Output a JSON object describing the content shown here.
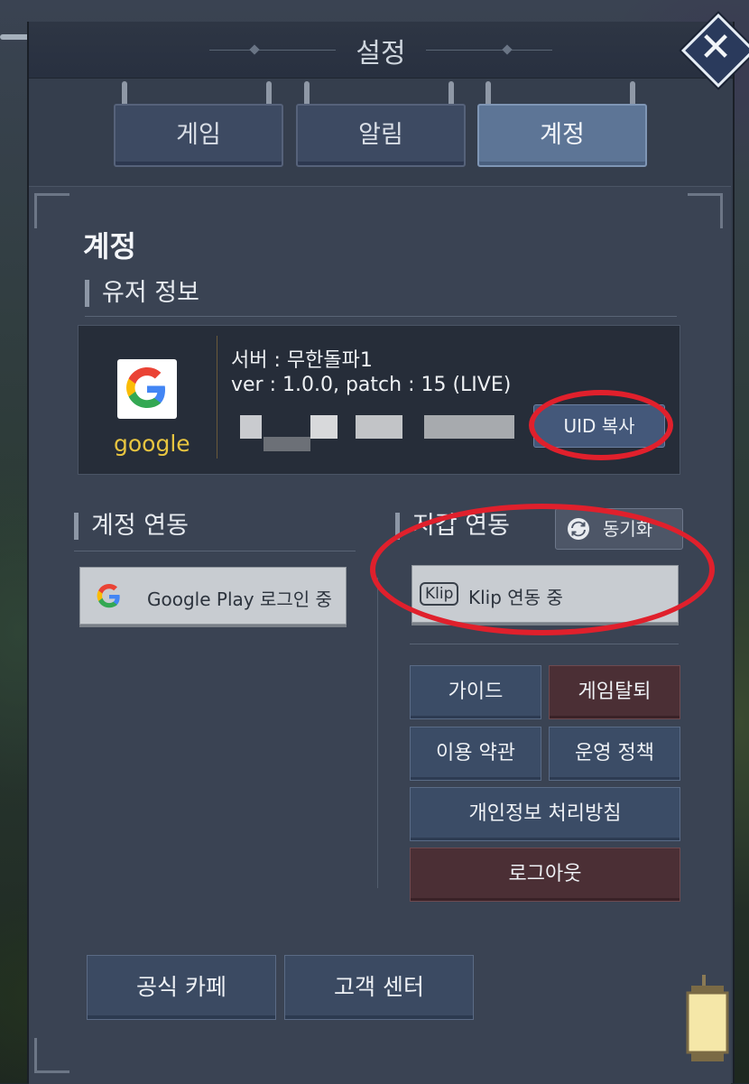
{
  "window": {
    "title": "설정"
  },
  "tabs": [
    {
      "label": "게임",
      "active": false
    },
    {
      "label": "알림",
      "active": false
    },
    {
      "label": "계정",
      "active": true
    }
  ],
  "account": {
    "heading": "계정",
    "user_info": {
      "section_title": "유저 정보",
      "provider_name": "google",
      "server": "서버 : 무한돌파1",
      "version": "ver : 1.0.0, patch : 15 (LIVE)",
      "uid_copy_label": "UID 복사"
    },
    "account_link": {
      "section_title": "계정 연동",
      "google_button_label": "Google Play 로그인 중"
    },
    "wallet_link": {
      "section_title": "지갑 연동",
      "sync_label": "동기화",
      "klip_logo": "Klip",
      "klip_button_label": "Klip 연동 중"
    },
    "menu": {
      "guide": "가이드",
      "withdraw": "게임탈퇴",
      "terms": "이용 약관",
      "policy": "운영 정책",
      "privacy": "개인정보 처리방침",
      "logout": "로그아웃"
    },
    "footer": {
      "cafe": "공식 카페",
      "support": "고객 센터"
    }
  },
  "colors": {
    "panel": "#353e4d",
    "accent_red": "#e0202c",
    "google_text": "#e8c540",
    "danger_button": "#4b2f35"
  },
  "icons": [
    "close-icon",
    "google-logo-icon",
    "sync-icon",
    "klip-logo-icon",
    "lantern-icon"
  ]
}
